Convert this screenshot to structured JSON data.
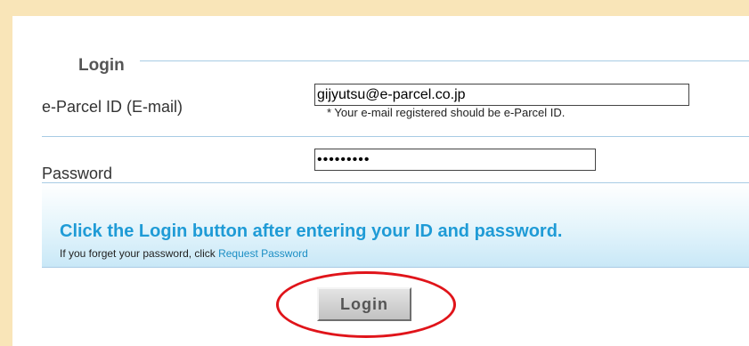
{
  "form": {
    "legend": "Login",
    "id_label": "e-Parcel ID (E-mail)",
    "id_value": "gijyutsu@e-parcel.co.jp",
    "id_hint": "* Your e-mail registered should be e-Parcel ID.",
    "password_label": "Password",
    "password_value": "123456789"
  },
  "info": {
    "main_text": "Click the Login button after entering your ID and password.",
    "sub_text": "If you forget your password, click ",
    "link_text": "Request Password"
  },
  "actions": {
    "login_label": "Login"
  },
  "colors": {
    "background": "#f9e5b8",
    "accent": "#1f9bd6",
    "highlight_circle": "#e0141a"
  }
}
